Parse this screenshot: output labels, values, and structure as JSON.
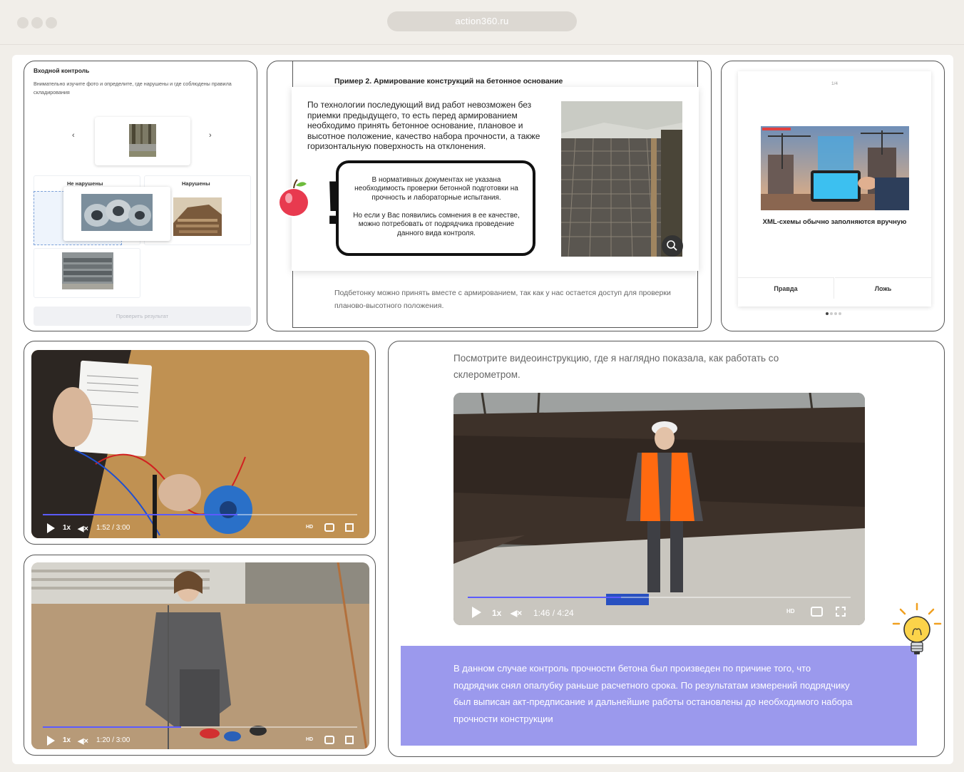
{
  "browser": {
    "url": "action360.ru"
  },
  "card1": {
    "title": "Входной контроль",
    "instruction": "Внимательно изучите фото и определите, где нарушены и где соблюдены правила складирования",
    "prev": "‹",
    "next": "›",
    "zone_ok": "Не нарушены",
    "zone_bad": "Нарушены",
    "check_button": "Проверить результат"
  },
  "card2": {
    "title": "Пример 2. Армирование конструкций на бетонное основание",
    "paragraph": "По технологии последующий вид работ невозможен без приемки предыдущего, то есть перед армированием необходимо принять бетонное основание, плановое и высотное положение, качество набора прочности, а также горизонтальную поверхность на отклонения.",
    "note1": "В нормативных документах не указана необходимость проверки бетонной подготовки на прочность и лабораторные испытания.",
    "note2": "Но если у Вас появились сомнения в ее качестве, можно потребовать от подрядчика проведение данного вида контроля.",
    "exclamation": "!",
    "footer": "Подбетонку можно принять вместе с армированием, так как у нас остается доступ для проверки планово-высотного положения."
  },
  "card3": {
    "counter": "1/4",
    "statement": "XML-схемы обычно заполняются вручную",
    "true_label": "Правда",
    "false_label": "Ложь"
  },
  "video1": {
    "speed": "1x",
    "time": "1:52 / 3:00",
    "progress": 0.62,
    "hd": "HD"
  },
  "video2": {
    "speed": "1x",
    "time": "1:20 / 3:00",
    "progress": 0.44,
    "hd": "HD"
  },
  "card6": {
    "intro": "Посмотрите видеоинструкцию, где я наглядно показала, как работать со склерометром.",
    "video": {
      "speed": "1x",
      "time": "1:46 / 4:24",
      "progress": 0.4,
      "hd": "HD"
    },
    "highlight": "В данном случае контроль прочности бетона был произведен по причине того, что подрядчик снял опалубку раньше расчетного срока. По результатам измерений подрядчику был выписан акт-предписание и дальнейшие работы остановлены до необходимого набора прочности конструкции"
  },
  "colors": {
    "accent": "#9b99ed",
    "progress": "#5b5bff",
    "bg": "#f1eee9"
  }
}
